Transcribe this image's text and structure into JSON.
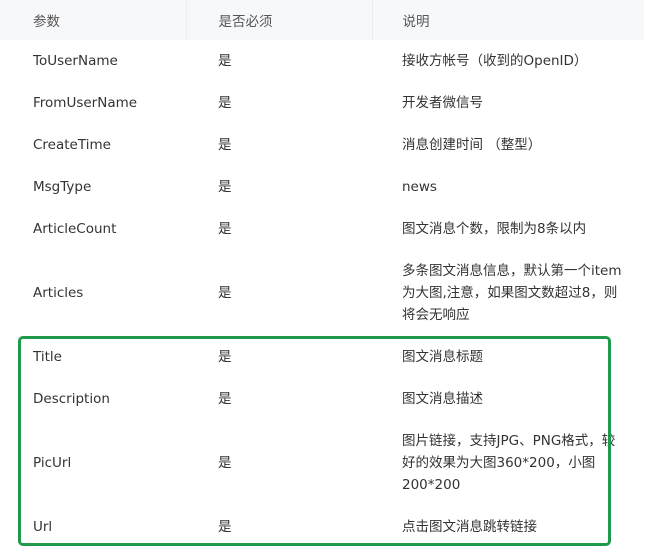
{
  "table": {
    "headers": [
      "参数",
      "是否必须",
      "说明"
    ],
    "rows": [
      {
        "param": "ToUserName",
        "required": "是",
        "desc": "接收方帐号（收到的OpenID）"
      },
      {
        "param": "FromUserName",
        "required": "是",
        "desc": "开发者微信号"
      },
      {
        "param": "CreateTime",
        "required": "是",
        "desc": "消息创建时间 （整型）"
      },
      {
        "param": "MsgType",
        "required": "是",
        "desc": "news"
      },
      {
        "param": "ArticleCount",
        "required": "是",
        "desc": "图文消息个数，限制为8条以内"
      },
      {
        "param": "Articles",
        "required": "是",
        "desc": "多条图文消息信息，默认第一个item为大图,注意，如果图文数超过8，则将会无响应"
      },
      {
        "param": "Title",
        "required": "是",
        "desc": "图文消息标题"
      },
      {
        "param": "Description",
        "required": "是",
        "desc": "图文消息描述"
      },
      {
        "param": "PicUrl",
        "required": "是",
        "desc": "图片链接，支持JPG、PNG格式，较好的效果为大图360*200，小图200*200"
      },
      {
        "param": "Url",
        "required": "是",
        "desc": "点击图文消息跳转链接"
      }
    ]
  },
  "highlight": {
    "color": "#1f9a4a"
  }
}
